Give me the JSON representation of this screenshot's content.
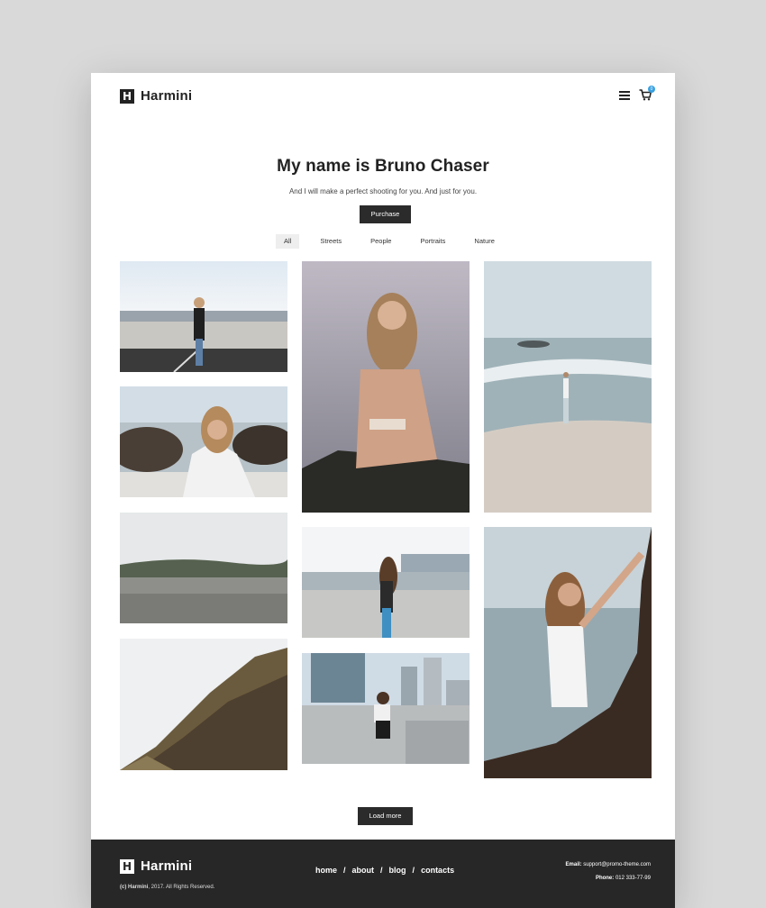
{
  "header": {
    "logo_mark": "H",
    "logo_text": "Harmini",
    "menu_icon": "hamburger-menu-icon",
    "cart_icon": "shopping-cart-icon",
    "cart_count": "0"
  },
  "hero": {
    "title": "My name is Bruno Chaser",
    "subtitle": "And I will make a perfect shooting for you. And just for you.",
    "purchase_label": "Purchase"
  },
  "filters": [
    {
      "label": "All",
      "active": true
    },
    {
      "label": "Streets",
      "active": false
    },
    {
      "label": "People",
      "active": false
    },
    {
      "label": "Portraits",
      "active": false
    },
    {
      "label": "Nature",
      "active": false
    }
  ],
  "load_more_label": "Load more",
  "footer": {
    "logo_mark": "H",
    "logo_text": "Harmini",
    "copyright_brand": "(c) Harmini",
    "copyright_rest": ", 2017. All Rights Reserved.",
    "nav": [
      "home",
      "about",
      "blog",
      "contacts"
    ],
    "nav_separator": "/",
    "email_label": "Email:",
    "email_value": "support@promo-theme.com",
    "phone_label": "Phone:",
    "phone_value": "012 333-77-99"
  },
  "colors": {
    "accent_badge": "#3aa0e0",
    "dark": "#2b2b2b",
    "footer_bg": "#272727"
  }
}
